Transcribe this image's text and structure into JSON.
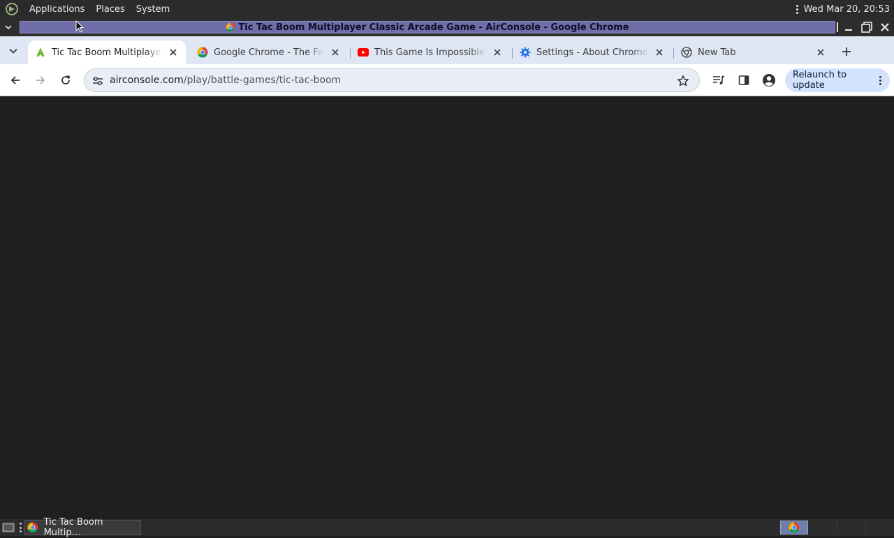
{
  "top_panel": {
    "menus": [
      "Applications",
      "Places",
      "System"
    ],
    "clock": "Wed Mar 20, 20:53"
  },
  "window": {
    "title": "Tic Tac Boom Multiplayer Classic Arcade Game - AirConsole - Google Chrome"
  },
  "tabs": [
    {
      "label": "Tic Tac Boom Multiplayer Classic Arcade Game - AirConsole",
      "favicon": "airconsole-icon",
      "active": true
    },
    {
      "label": "Google Chrome - The Fast & Secure Web Browser",
      "favicon": "chrome-icon",
      "active": false
    },
    {
      "label": "This Game Is Impossible To Beat",
      "favicon": "youtube-icon",
      "active": false
    },
    {
      "label": "Settings - About Chrome",
      "favicon": "settings-gear-icon",
      "active": false
    },
    {
      "label": "New Tab",
      "favicon": "chrome-mono-icon",
      "active": false
    }
  ],
  "toolbar": {
    "url_domain": "airconsole.com",
    "url_path": "/play/battle-games/tic-tac-boom",
    "relaunch_label": "Relaunch to update"
  },
  "taskbar": {
    "window_button_label": "Tic Tac Boom Multip…"
  },
  "colors": {
    "content_bg": "#1f1f1f",
    "tabstrip_bg": "#dfe7f5",
    "title_strip": "#6f6ea8",
    "relaunch_bg": "#d3e3fd"
  }
}
